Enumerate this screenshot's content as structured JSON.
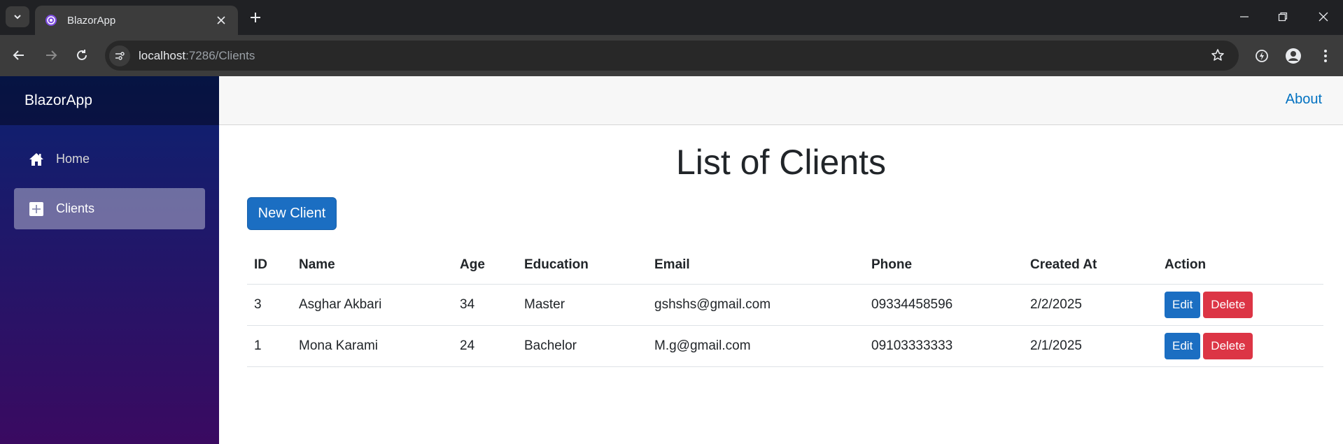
{
  "browser": {
    "tab_title": "BlazorApp",
    "url_host": "localhost",
    "url_rest": ":7286/Clients"
  },
  "sidebar": {
    "brand": "BlazorApp",
    "items": [
      {
        "label": "Home",
        "icon": "home-icon",
        "active": false
      },
      {
        "label": "Clients",
        "icon": "plus-square-icon",
        "active": true
      }
    ]
  },
  "header": {
    "about_link": "About"
  },
  "main": {
    "title": "List of Clients",
    "new_button": "New Client",
    "table": {
      "columns": [
        "ID",
        "Name",
        "Age",
        "Education",
        "Email",
        "Phone",
        "Created At",
        "Action"
      ],
      "rows": [
        {
          "id": "3",
          "name": "Asghar Akbari",
          "age": "34",
          "education": "Master",
          "email": "gshshs@gmail.com",
          "phone": "09334458596",
          "created_at": "2/2/2025"
        },
        {
          "id": "1",
          "name": "Mona Karami",
          "age": "24",
          "education": "Bachelor",
          "email": "M.g@gmail.com",
          "phone": "09103333333",
          "created_at": "2/1/2025"
        }
      ],
      "edit_label": "Edit",
      "delete_label": "Delete"
    }
  },
  "colors": {
    "primary": "#1b6ec2",
    "danger": "#dc3545",
    "link": "#0071c1"
  }
}
